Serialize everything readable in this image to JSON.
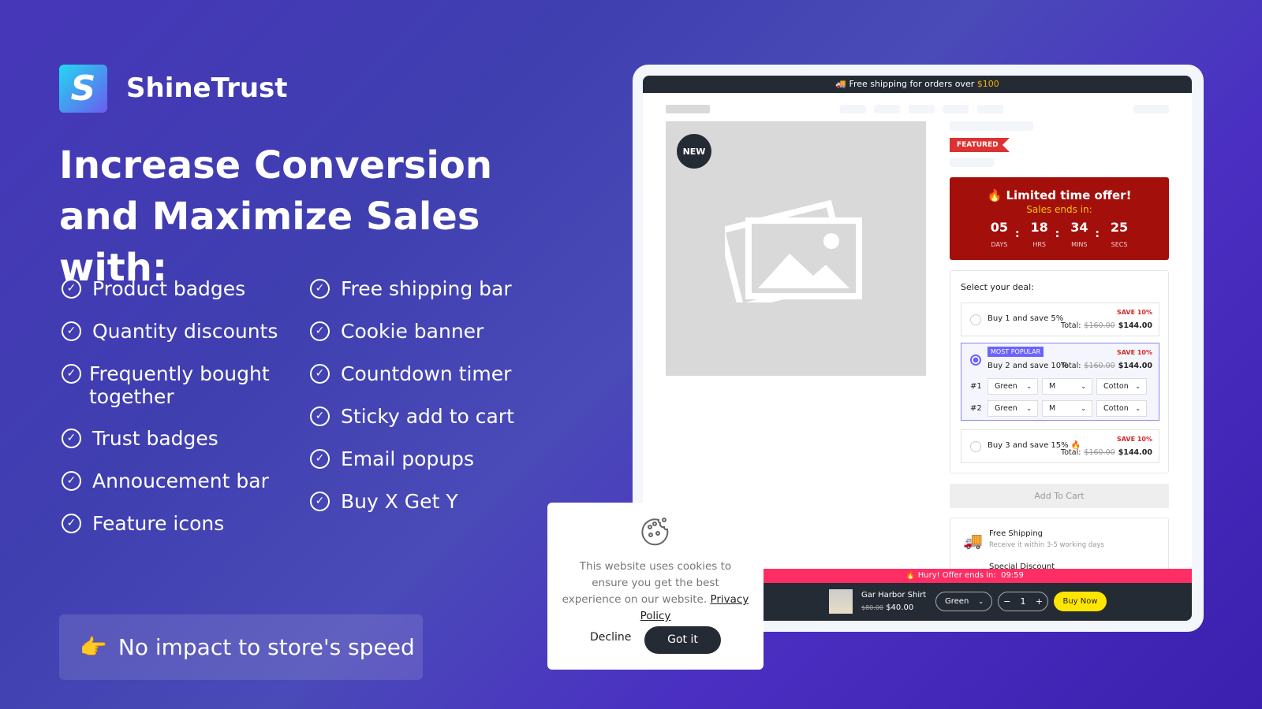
{
  "brand": {
    "name": "ShineTrust",
    "logo_letter": "S"
  },
  "headline": "Increase Conversion and Maximize Sales with:",
  "features_left": [
    "Product badges",
    "Quantity discounts",
    "Frequently bought together",
    "Trust badges",
    "Annoucement bar",
    "Feature icons"
  ],
  "features_right": [
    "Free shipping bar",
    "Cookie banner",
    "Countdown timer",
    "Sticky add to cart",
    "Email popups",
    "Buy X Get Y"
  ],
  "speed": {
    "emoji": "👉",
    "text": "No impact to store's speed"
  },
  "store": {
    "shipping_bar": {
      "text": "Free shipping for orders over ",
      "amount": "$100",
      "icon": "🚚"
    },
    "new_badge": "NEW",
    "featured_badge": "FEATURED",
    "offer": {
      "title": "🔥 Limited time offer!",
      "subtitle": "Sales ends in:",
      "days": "05",
      "days_label": "DAYS",
      "hrs": "18",
      "hrs_label": "HRS",
      "mins": "34",
      "mins_label": "MINS",
      "secs": "25",
      "secs_label": "SECS"
    },
    "deal": {
      "title": "Select your deal:",
      "options": [
        {
          "label": "Buy 1 and save 5%",
          "save": "SAVE 10%",
          "total_label": "Total:",
          "old": "$160.00",
          "price": "$144.00"
        },
        {
          "label": "Buy 2 and save 10%",
          "badge": "MOST POPULAR",
          "save": "SAVE 10%",
          "total_label": "Total:",
          "old": "$160.00",
          "price": "$144.00",
          "rows": [
            {
              "n": "#1",
              "color": "Green",
              "size": "M",
              "material": "Cotton"
            },
            {
              "n": "#2",
              "color": "Green",
              "size": "M",
              "material": "Cotton"
            }
          ]
        },
        {
          "label": "Buy 3 and save 15% 🔥",
          "save": "SAVE 10%",
          "total_label": "Total:",
          "old": "$160.00",
          "price": "$144.00"
        }
      ]
    },
    "add_to_cart": "Add To Cart",
    "feature_icons": [
      {
        "title": "Free Shipping",
        "desc": "Receive it within 3-5 working days"
      },
      {
        "title": "Special Discount"
      }
    ],
    "sticky": {
      "hurry": "🔥 Hury! Offer ends in:",
      "timer": "09:59",
      "product": "Gar Harbor Shirt",
      "old": "$80.00",
      "price": "$40.00",
      "variant": "Green",
      "qty": "1",
      "buy": "Buy Now"
    }
  },
  "cookie": {
    "text": "This website uses cookies to ensure you get the best experience on our website.",
    "link": "Privacy Policy",
    "decline": "Decline",
    "accept": "Got it"
  },
  "colors": {
    "accent": "#6c63ff",
    "offer_red": "#a3100c",
    "pink": "#fe2d64",
    "buy_yellow": "#ffe600",
    "dark": "#252b35"
  }
}
